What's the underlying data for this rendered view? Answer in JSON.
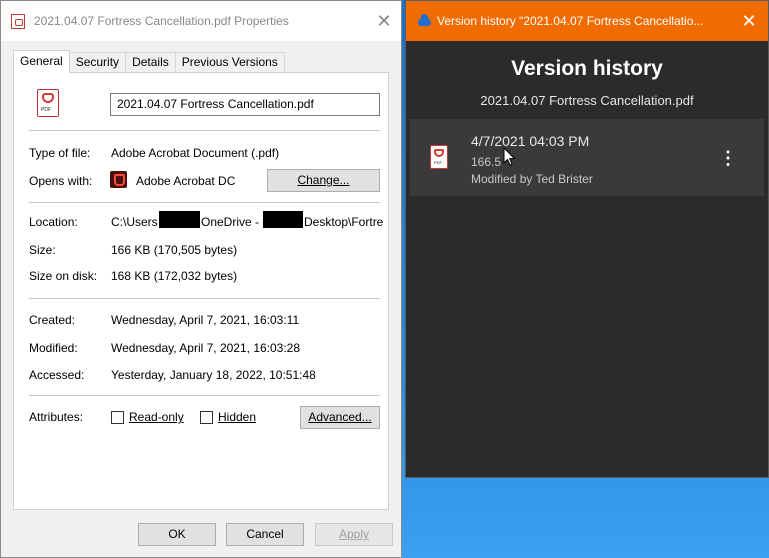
{
  "properties": {
    "title": "2021.04.07 Fortress Cancellation.pdf Properties",
    "tabs": [
      {
        "label": "General",
        "active": true
      },
      {
        "label": "Security",
        "active": false
      },
      {
        "label": "Details",
        "active": false
      },
      {
        "label": "Previous Versions",
        "active": false
      }
    ],
    "filename": "2021.04.07 Fortress Cancellation.pdf",
    "type_label": "Type of file:",
    "type_value": "Adobe Acrobat Document (.pdf)",
    "opens_label": "Opens with:",
    "opens_value": "Adobe Acrobat DC",
    "change_btn": "Change...",
    "location_label": "Location:",
    "location_parts": [
      "C:\\Users",
      "OneDrive - ",
      "Desktop\\Fortre"
    ],
    "size_label": "Size:",
    "size_value": "166 KB (170,505 bytes)",
    "size_disk_label": "Size on disk:",
    "size_disk_value": "168 KB (172,032 bytes)",
    "created_label": "Created:",
    "created_value": "Wednesday, April 7, 2021, 16:03:11",
    "modified_label": "Modified:",
    "modified_value": "Wednesday, April 7, 2021, 16:03:28",
    "accessed_label": "Accessed:",
    "accessed_value": "Yesterday, January 18, 2022, 10:51:48",
    "attributes_label": "Attributes:",
    "readonly_label": "Read-only",
    "hidden_label": "Hidden",
    "advanced_btn": "Advanced...",
    "ok_btn": "OK",
    "cancel_btn": "Cancel",
    "apply_btn": "Apply",
    "close_glyph": "✕",
    "icon_file": "pdf-file-icon",
    "icon_file_tag": "PDF"
  },
  "version_history": {
    "title": "Version history \"2021.04.07 Fortress Cancellatio...",
    "close_glyph": "✕",
    "heading": "Version history",
    "filename": "2021.04.07 Fortress Cancellation.pdf",
    "entries": [
      {
        "date": "4/7/2021 04:03 PM",
        "size": "166.5",
        "modified_by": "Modified by Ted Brister",
        "more_glyph": "⋮",
        "icon_tag": "PDF"
      }
    ],
    "colors": {
      "titlebar": "#f06c00",
      "background": "#2b2b2b",
      "entry": "#3a3a3a"
    }
  }
}
